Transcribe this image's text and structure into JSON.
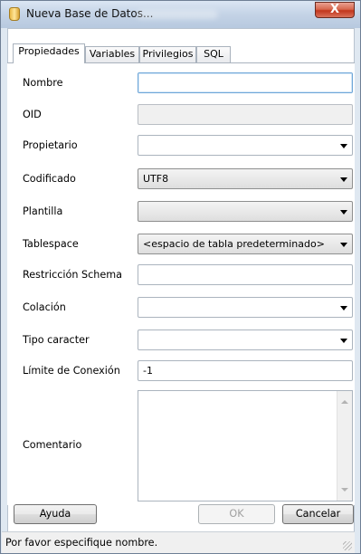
{
  "window": {
    "title": "Nueva Base de Datos...",
    "close_label": "X"
  },
  "tabs": [
    {
      "label": "Propiedades",
      "active": true
    },
    {
      "label": "Variables",
      "active": false
    },
    {
      "label": "Privilegios",
      "active": false
    },
    {
      "label": "SQL",
      "active": false
    }
  ],
  "form": {
    "nombre": {
      "label": "Nombre",
      "value": ""
    },
    "oid": {
      "label": "OID",
      "value": ""
    },
    "propietario": {
      "label": "Propietario",
      "value": ""
    },
    "codificado": {
      "label": "Codificado",
      "value": "UTF8"
    },
    "plantilla": {
      "label": "Plantilla",
      "value": ""
    },
    "tablespace": {
      "label": "Tablespace",
      "value": "<espacio de tabla predeterminado>"
    },
    "restriccion_schema": {
      "label": "Restricción Schema",
      "value": ""
    },
    "colacion": {
      "label": "Colación",
      "value": ""
    },
    "tipo_caracter": {
      "label": "Tipo caracter",
      "value": ""
    },
    "limite_conexion": {
      "label": "Límite de Conexión",
      "value": "-1"
    },
    "comentario": {
      "label": "Comentario",
      "value": ""
    }
  },
  "buttons": {
    "help": "Ayuda",
    "ok": "OK",
    "cancel": "Cancelar"
  },
  "status": {
    "text": "Por favor especifique nombre."
  },
  "colors": {
    "focus_border": "#6ea6d8",
    "close_button": "#c2361d",
    "titlebar": "#c4d3e6"
  }
}
